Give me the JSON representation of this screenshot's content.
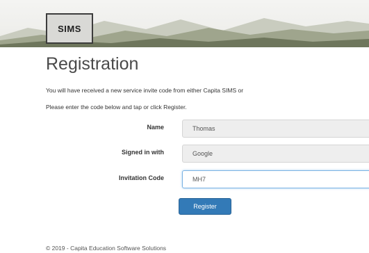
{
  "header": {
    "logo_text": "SIMS"
  },
  "main": {
    "title": "Registration",
    "intro_line_1": "You will have received a new service invite code from either Capita SIMS or",
    "intro_line_2": "Please enter the code below and tap or click Register."
  },
  "form": {
    "name": {
      "label": "Name",
      "value": "Thomas"
    },
    "signed_in_with": {
      "label": "Signed in with",
      "value": "Google"
    },
    "invitation_code": {
      "label": "Invitation Code",
      "value": "MH7"
    },
    "register_label": "Register"
  },
  "footer": {
    "copyright": "© 2019 - Capita Education Software Solutions"
  }
}
